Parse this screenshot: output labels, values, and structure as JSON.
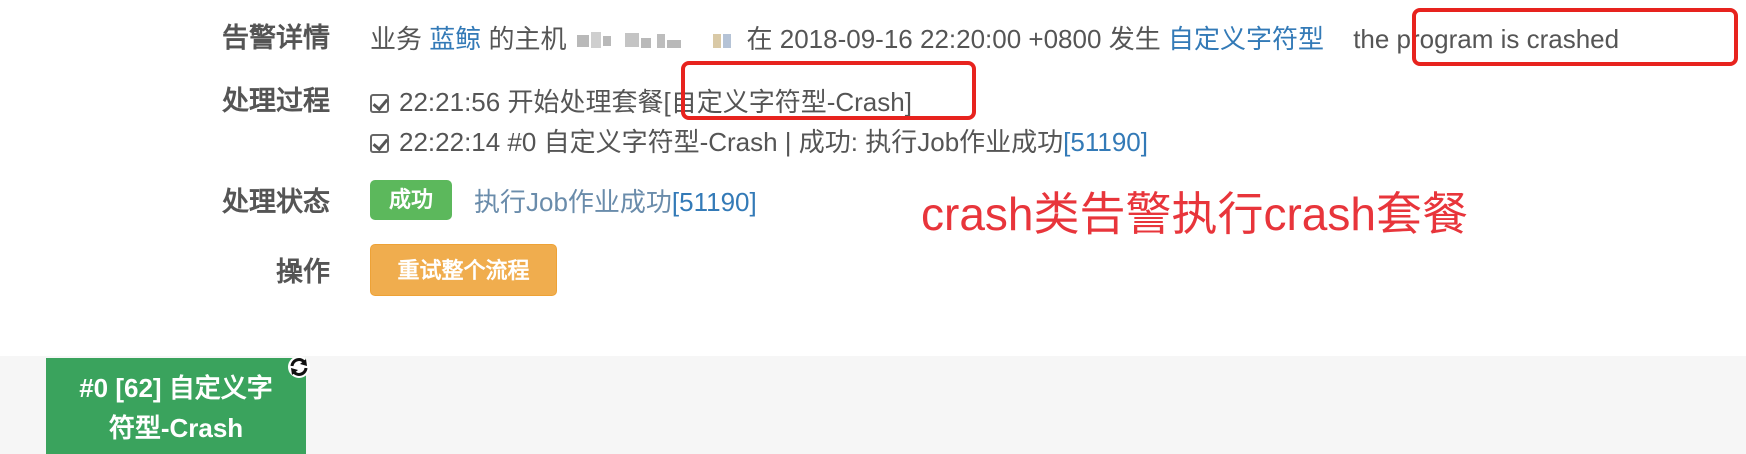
{
  "labels": {
    "alert_detail": "告警详情",
    "process": "处理过程",
    "status": "处理状态",
    "action": "操作"
  },
  "alert_detail": {
    "prefix": "业务",
    "business": "蓝鲸",
    "host_text": "的主机",
    "at": "在",
    "time": "2018-09-16 22:20:00 +0800",
    "occurred": "发生",
    "type": "自定义字符型",
    "message": "the program is crashed"
  },
  "process": {
    "step1_time": "22:21:56",
    "step1_text": "开始处理套餐",
    "step1_package": "[自定义字符型-Crash]",
    "step2_text": "22:22:14 #0 自定义字符型-Crash | 成功: 执行Job作业成功",
    "step2_link": "[51190]"
  },
  "status": {
    "badge": "成功",
    "text": "执行Job作业成功",
    "link": "[51190]"
  },
  "actions": {
    "retry": "重试整个流程"
  },
  "annotation": "crash类告警执行crash套餐",
  "flow": {
    "node_line1": "#0 [62] 自定义字",
    "node_line2": "符型-Crash"
  },
  "colors": {
    "link": "#337ab7",
    "success": "#5cb85c",
    "warning": "#f0ad4e",
    "annotation": "#e8353b",
    "highlight_box": "#e7231e",
    "flow_node": "#3aa35d"
  }
}
